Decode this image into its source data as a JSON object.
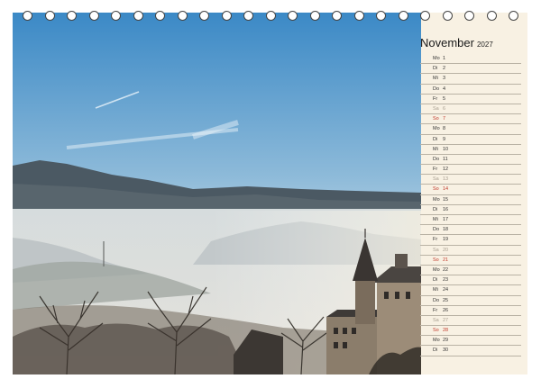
{
  "calendar": {
    "month": "November",
    "year": "2027",
    "days": [
      {
        "wd": "Mo",
        "n": "1",
        "type": "weekday"
      },
      {
        "wd": "Di",
        "n": "2",
        "type": "weekday"
      },
      {
        "wd": "Mi",
        "n": "3",
        "type": "weekday"
      },
      {
        "wd": "Do",
        "n": "4",
        "type": "weekday"
      },
      {
        "wd": "Fr",
        "n": "5",
        "type": "weekday"
      },
      {
        "wd": "Sa",
        "n": "6",
        "type": "sat"
      },
      {
        "wd": "So",
        "n": "7",
        "type": "sun"
      },
      {
        "wd": "Mo",
        "n": "8",
        "type": "weekday"
      },
      {
        "wd": "Di",
        "n": "9",
        "type": "weekday"
      },
      {
        "wd": "Mi",
        "n": "10",
        "type": "weekday"
      },
      {
        "wd": "Do",
        "n": "11",
        "type": "weekday"
      },
      {
        "wd": "Fr",
        "n": "12",
        "type": "weekday"
      },
      {
        "wd": "Sa",
        "n": "13",
        "type": "sat"
      },
      {
        "wd": "So",
        "n": "14",
        "type": "sun"
      },
      {
        "wd": "Mo",
        "n": "15",
        "type": "weekday"
      },
      {
        "wd": "Di",
        "n": "16",
        "type": "weekday"
      },
      {
        "wd": "Mi",
        "n": "17",
        "type": "weekday"
      },
      {
        "wd": "Do",
        "n": "18",
        "type": "weekday"
      },
      {
        "wd": "Fr",
        "n": "19",
        "type": "weekday"
      },
      {
        "wd": "Sa",
        "n": "20",
        "type": "sat"
      },
      {
        "wd": "So",
        "n": "21",
        "type": "sun"
      },
      {
        "wd": "Mo",
        "n": "22",
        "type": "weekday"
      },
      {
        "wd": "Di",
        "n": "23",
        "type": "weekday"
      },
      {
        "wd": "Mi",
        "n": "24",
        "type": "weekday"
      },
      {
        "wd": "Do",
        "n": "25",
        "type": "weekday"
      },
      {
        "wd": "Fr",
        "n": "26",
        "type": "weekday"
      },
      {
        "wd": "Sa",
        "n": "27",
        "type": "sat"
      },
      {
        "wd": "So",
        "n": "28",
        "type": "sun"
      },
      {
        "wd": "Mo",
        "n": "29",
        "type": "weekday"
      },
      {
        "wd": "Di",
        "n": "30",
        "type": "weekday"
      }
    ]
  },
  "colors": {
    "panel": "#f8f1e3",
    "sky_top": "#3d8bc7",
    "sky_bottom": "#dce9f1",
    "sunday": "#c0392b",
    "saturday": "#a79e90"
  },
  "binding_rings": 23
}
